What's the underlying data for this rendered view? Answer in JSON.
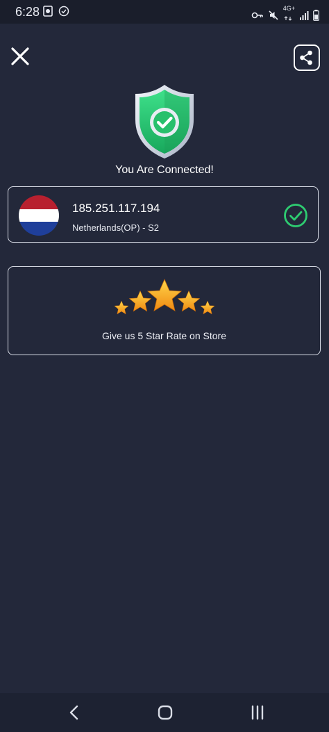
{
  "status_bar": {
    "time": "6:28",
    "network": "4G+"
  },
  "header": {
    "close_icon": "close-icon",
    "share_icon": "share-icon"
  },
  "connection": {
    "status_text": "You Are Connected!",
    "shield_icon": "shield-check-icon"
  },
  "server": {
    "ip": "185.251.117.194",
    "name": "Netherlands(OP) - S2",
    "flag": "netherlands-flag",
    "selected": true
  },
  "rating": {
    "text": "Give us 5 Star Rate on Store",
    "stars": 5
  },
  "colors": {
    "background": "#23283a",
    "accent_green": "#2ecc71",
    "star_gold": "#f7a91e"
  }
}
